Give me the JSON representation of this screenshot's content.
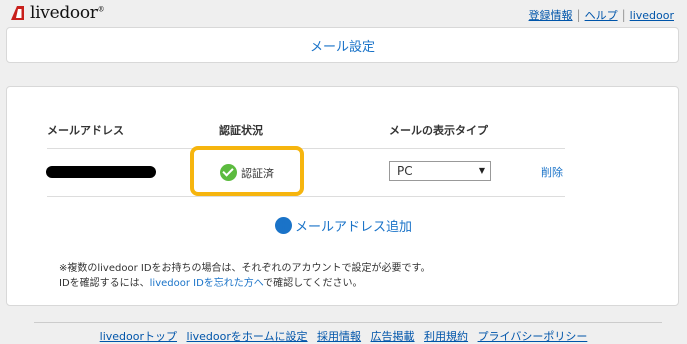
{
  "header": {
    "logo_text": "livedoor",
    "links": [
      "登録情報",
      "ヘルプ",
      "livedoor"
    ]
  },
  "page_title": "メール設定",
  "table": {
    "headers": [
      "メールアドレス",
      "認証状況",
      "メールの表示タイプ"
    ],
    "row": {
      "status": "認証済",
      "display_type": "PC",
      "delete_label": "削除"
    }
  },
  "add_email_label": "メールアドレス追加",
  "notes": {
    "line1": "※複数のlivedoor IDをお持ちの場合は、それぞれのアカウントで設定が必要です。",
    "line2_pre": "IDを確認するには、",
    "line2_link": "livedoor IDを忘れた方へ",
    "line2_post": "で確認してください。"
  },
  "footer": {
    "links": [
      "livedoorトップ",
      "livedoorをホームに設定",
      "採用情報",
      "広告掲載",
      "利用規約",
      "プライバシーポリシー"
    ]
  },
  "colors": {
    "accent": "#1a73c8",
    "highlight": "#f6b50e",
    "verified": "#5cbb3f"
  }
}
